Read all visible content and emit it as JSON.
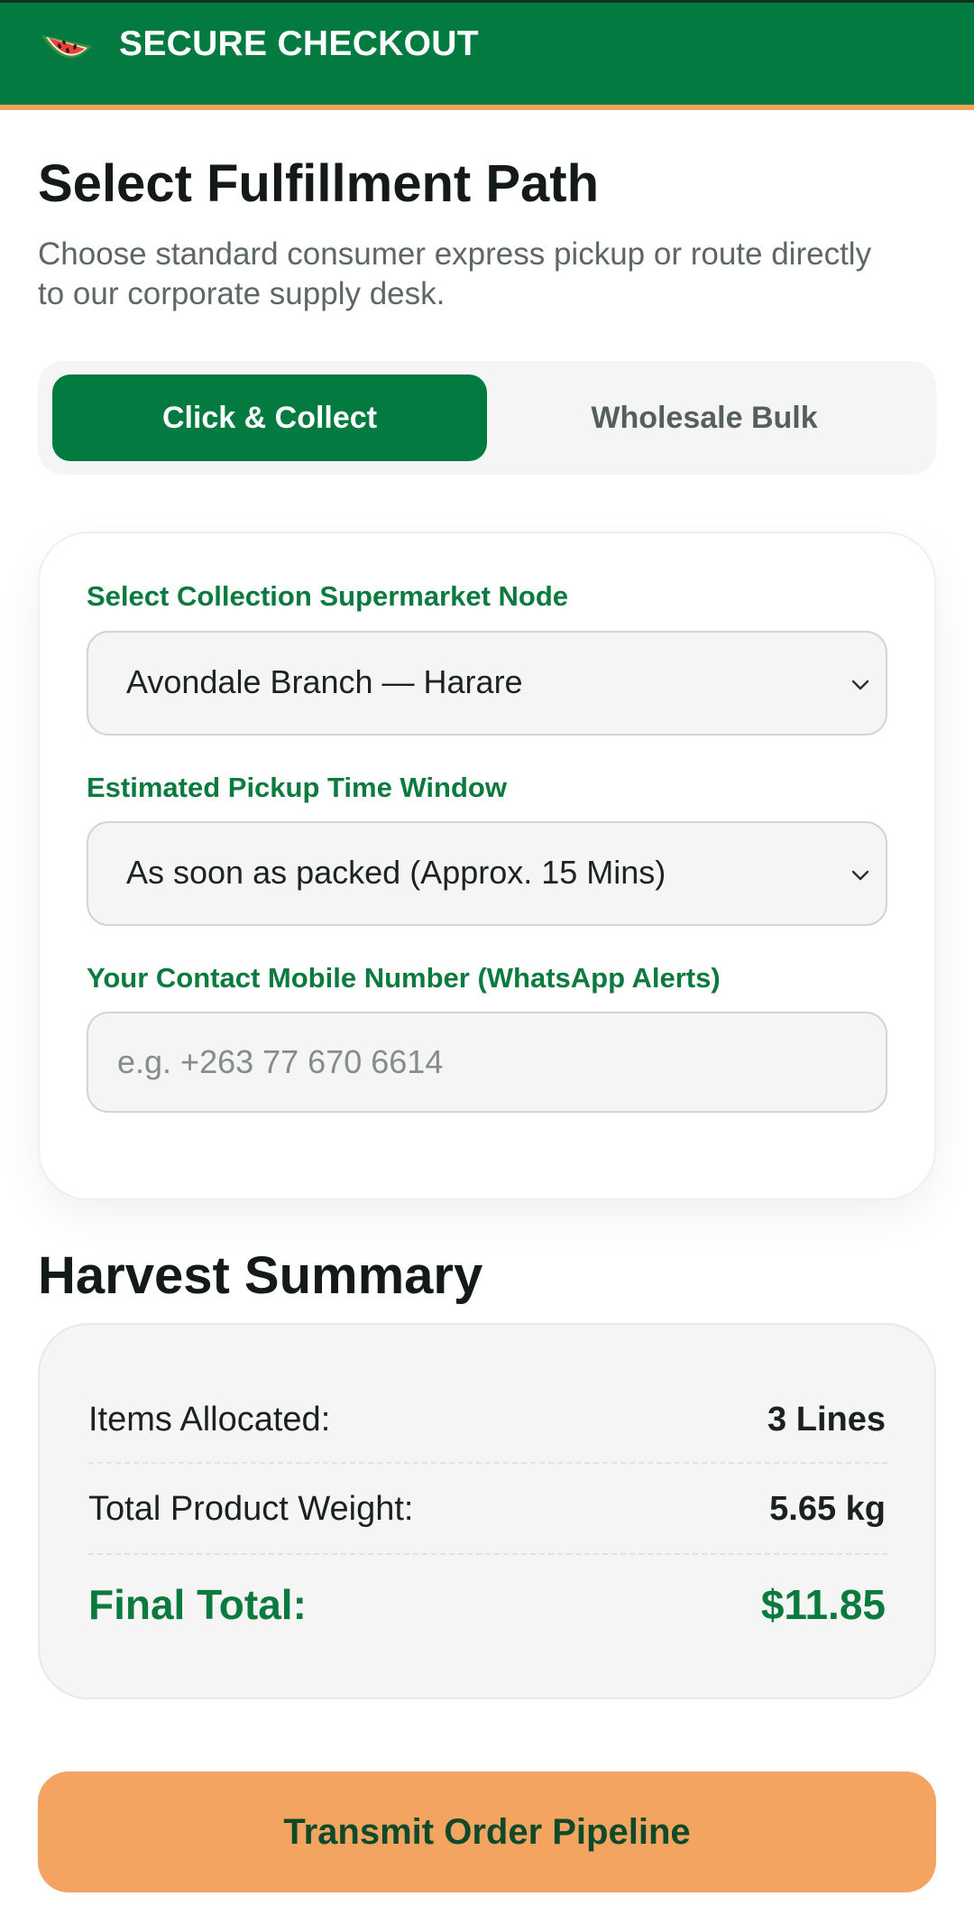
{
  "header": {
    "title": "SECURE CHECKOUT",
    "logo_icon": "watermelon-icon"
  },
  "intro": {
    "title": "Select Fulfillment Path",
    "subtitle": "Choose standard consumer express pickup or route directly to our corporate supply desk."
  },
  "fulfillment_tabs": [
    {
      "label": "Click & Collect",
      "active": true
    },
    {
      "label": "Wholesale Bulk",
      "active": false
    }
  ],
  "form": {
    "branch": {
      "label": "Select Collection Supermarket Node",
      "selected": "Avondale Branch — Harare"
    },
    "pickup_window": {
      "label": "Estimated Pickup Time Window",
      "selected": "As soon as packed (Approx. 15 Mins)"
    },
    "phone": {
      "label": "Your Contact Mobile Number (WhatsApp Alerts)",
      "placeholder": "e.g. +263 77 670 6614",
      "value": ""
    }
  },
  "summary": {
    "title": "Harvest Summary",
    "rows": [
      {
        "label": "Items Allocated:",
        "value": "3 Lines"
      },
      {
        "label": "Total Product Weight:",
        "value": "5.65 kg"
      }
    ],
    "final": {
      "label": "Final Total:",
      "value": "$11.85"
    }
  },
  "cta": {
    "label": "Transmit Order Pipeline"
  },
  "colors": {
    "brand_green": "#037a3f",
    "accent_orange": "#f2a460",
    "label_green": "#0b7a3e"
  }
}
